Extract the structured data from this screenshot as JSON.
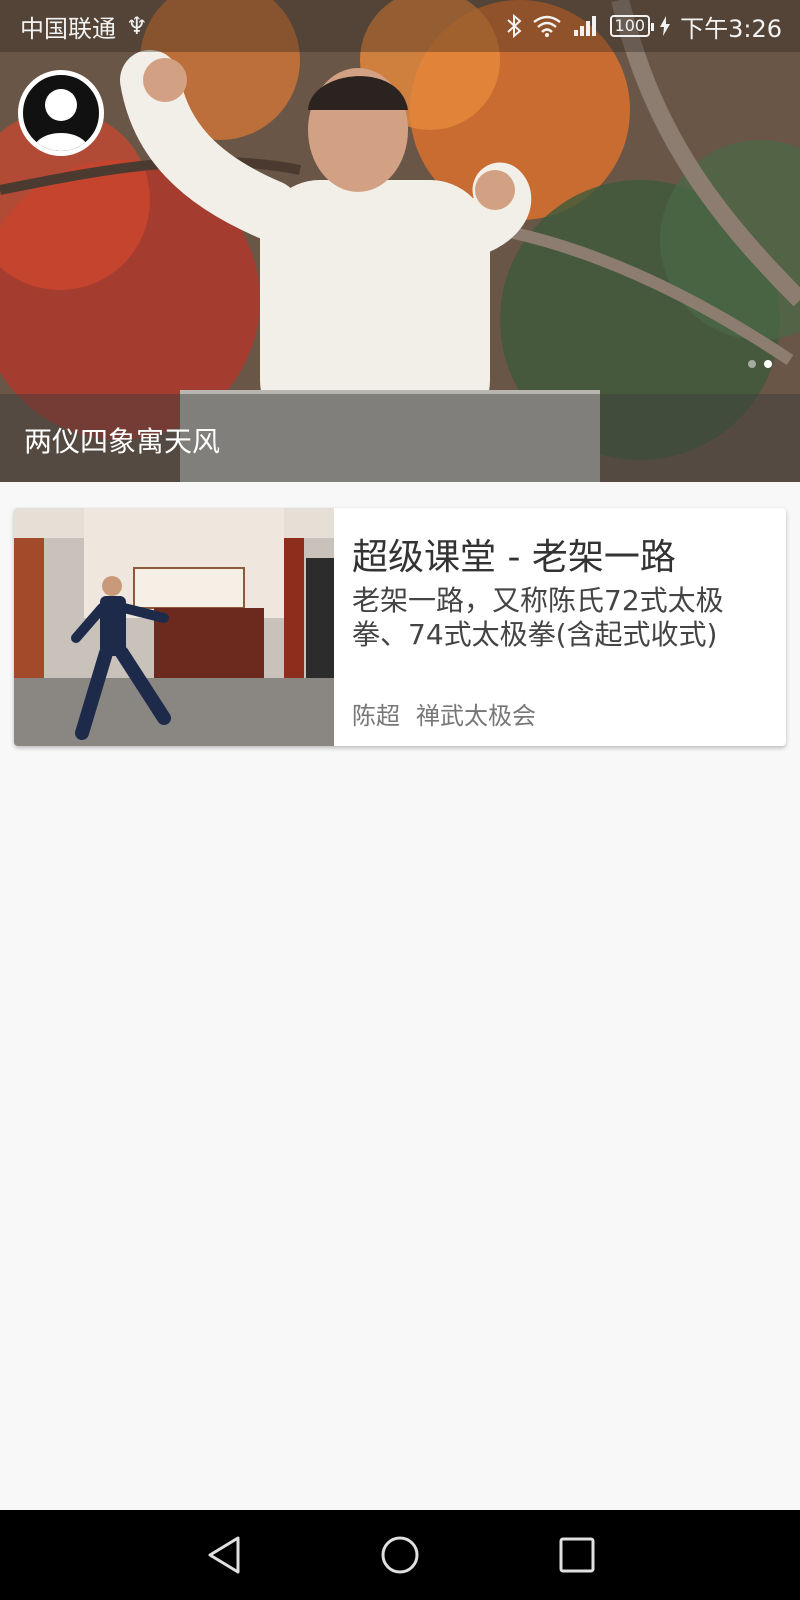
{
  "status_bar": {
    "carrier": "中国联通",
    "usb_symbol": "♆",
    "battery": "100",
    "time": "下午3:26"
  },
  "banner": {
    "caption": "两仪四象寓天风",
    "slide_count": 2,
    "active_slide": 2
  },
  "course_card": {
    "title": "超级课堂 - 老架一路",
    "description": "老架一路，又称陈氏72式太极拳、74式太极拳(含起式收式)",
    "author": "陈超",
    "organization": "禅武太极会",
    "thumbnail_icon": "tai-chi-practice-photo"
  },
  "nav_bar": {
    "back_icon": "triangle-back-icon",
    "home_icon": "circle-home-icon",
    "recents_icon": "square-recents-icon"
  }
}
